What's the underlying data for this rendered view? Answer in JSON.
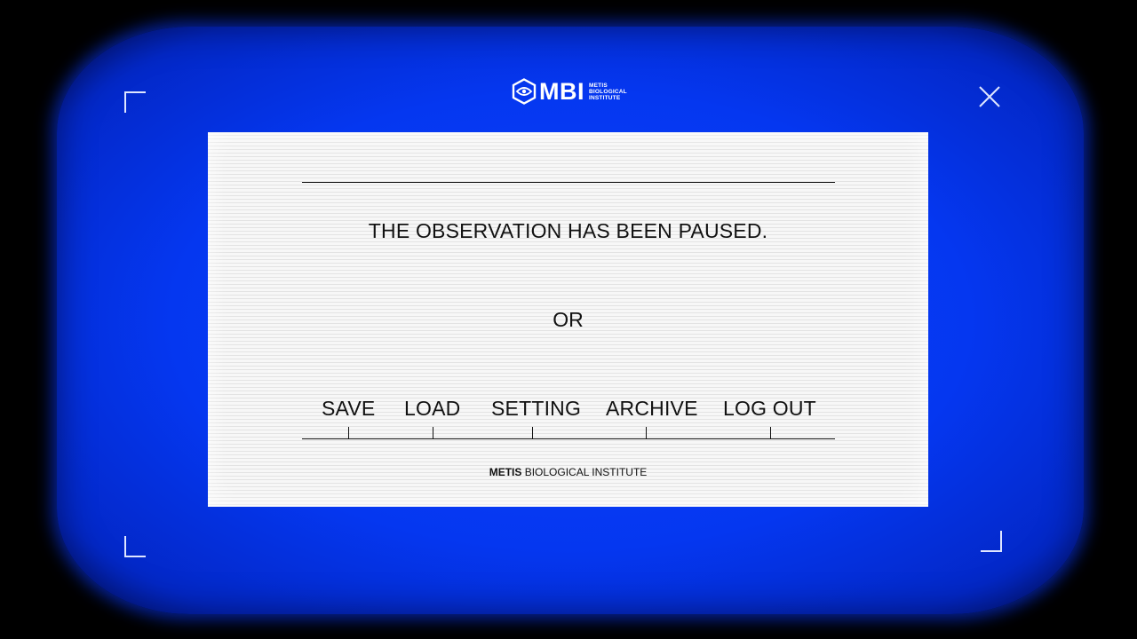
{
  "logo": {
    "text": "MBI",
    "sub_line1": "METIS",
    "sub_line2": "BIOLOGICAL",
    "sub_line3": "INSTITUTE",
    "icon": "hexagon-eye-icon"
  },
  "close": {
    "icon": "close-icon"
  },
  "dialog": {
    "message": "THE OBSERVATION HAS BEEN PAUSED.",
    "or_label": "OR",
    "menu": {
      "save": "SAVE",
      "load": "LOAD",
      "setting": "SETTING",
      "archive": "ARCHIVE",
      "logout": "LOG OUT"
    },
    "footer_bold": "METIS",
    "footer_rest": " BIOLOGICAL INSTITUTE"
  },
  "colors": {
    "screen_blue": "#0537f0",
    "panel_bg": "#f4f4f4",
    "text": "#111111",
    "frame_lines": "#dfe6ff"
  }
}
